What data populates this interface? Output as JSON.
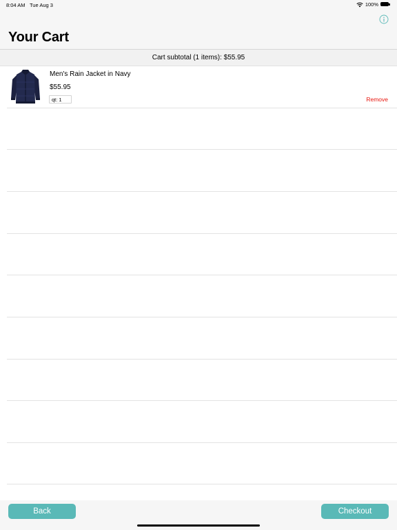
{
  "status_bar": {
    "time": "8:04 AM",
    "date": "Tue Aug 3",
    "battery": "100%"
  },
  "header": {
    "title": "Your Cart",
    "info_icon": "info-circle-icon",
    "accent_color": "#5ab9b7"
  },
  "subtotal": {
    "text": "Cart subtotal (1 items): $55.95"
  },
  "cart": {
    "items": [
      {
        "name": "Men's Rain Jacket in Navy",
        "price": "$55.95",
        "quantity_label": "qt: 1",
        "remove_label": "Remove",
        "image_icon": "navy-rain-jacket-image"
      }
    ]
  },
  "toolbar": {
    "back_label": "Back",
    "checkout_label": "Checkout"
  },
  "colors": {
    "button_bg": "#5ab9b7",
    "remove_text": "#e8170f"
  }
}
